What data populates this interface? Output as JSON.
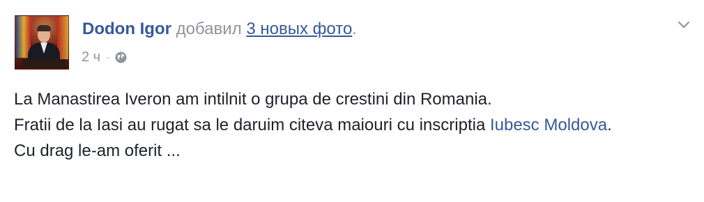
{
  "post": {
    "author": "Dodon Igor",
    "action": "добавил",
    "photos_link": "3 новых фото",
    "period": ".",
    "timestamp": "2 ч",
    "separator": "·",
    "audience_icon": "globe-icon",
    "menu_icon": "chevron-down-icon",
    "text": {
      "line1": "La Manastirea Iveron am intilnit o grupa de crestini din Romania.",
      "line2_prefix": "Fratii de la Iasi au rugat sa le daruim citeva maiouri cu inscriptia ",
      "line2_link": "Iubesc Moldova",
      "line2_suffix": ".",
      "line3": "Cu drag le-am oferit ..."
    }
  },
  "colors": {
    "link": "#365899",
    "meta": "#90949c",
    "text": "#1d2129",
    "background": "#ffffff"
  }
}
